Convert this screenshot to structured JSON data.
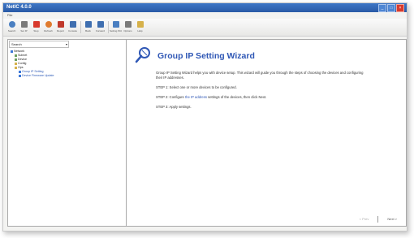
{
  "window": {
    "title": "NetIC 4.0.0",
    "controls": [
      "_",
      "□",
      "×"
    ]
  },
  "menu": {
    "label": "File"
  },
  "toolbar": {
    "groups": [
      {
        "items": [
          {
            "icon": "search-icon",
            "label": "Search",
            "color": "#4a7fc1"
          },
          {
            "icon": "pencil-icon",
            "label": "Set IP",
            "color": "#7a7a7a"
          },
          {
            "icon": "stop-icon",
            "label": "Stop",
            "color": "#d83a2d"
          },
          {
            "icon": "refresh-icon",
            "label": "Refresh",
            "color": "#e07b2e"
          },
          {
            "icon": "print-icon",
            "label": "Report",
            "color": "#c0392b"
          },
          {
            "icon": "monitor-icon",
            "label": "Console",
            "color": "#3f6fb0"
          }
        ]
      },
      {
        "items": [
          {
            "icon": "back-icon",
            "label": "Back",
            "color": "#3f6fb0"
          },
          {
            "icon": "forward-icon",
            "label": "Forward",
            "color": "#3f6fb0"
          }
        ]
      },
      {
        "items": [
          {
            "icon": "wizard-icon",
            "label": "Setting Wizard",
            "color": "#4a7fc1"
          },
          {
            "icon": "pin-icon",
            "label": "Options",
            "color": "#7a7a7a"
          },
          {
            "icon": "lock-icon",
            "label": "Help",
            "color": "#d6b14a"
          }
        ]
      }
    ]
  },
  "tree": {
    "selector": "Search",
    "nodes": [
      {
        "text": "Network",
        "indent": 0,
        "mark": "b"
      },
      {
        "text": "Subnet",
        "indent": 1,
        "mark": "g"
      },
      {
        "text": "Device",
        "indent": 1,
        "mark": "g"
      },
      {
        "text": "Config",
        "indent": 1,
        "mark": "y"
      },
      {
        "text": "Ops",
        "indent": 1,
        "mark": "y"
      },
      {
        "text": "Group IP Setting",
        "indent": 2,
        "mark": "b",
        "blue": true
      },
      {
        "text": "Device Firmware Update",
        "indent": 2,
        "mark": "b",
        "blue": true
      }
    ]
  },
  "wizard": {
    "title": "Group IP Setting Wizard",
    "intro": "Group IP Setting Wizard helps you with device setup. This wizard will guide you through the steps of choosing the devices and configuring their IP addresses.",
    "step1": "STEP 1: Select one or more devices to be configured.",
    "step2_prefix": "STEP 2: Configure ",
    "step2_link": "the IP address",
    "step2_suffix": " settings of the devices, then click Next.",
    "step3": "STEP 3: Apply settings."
  },
  "footer": {
    "prev": "< Prev",
    "next": "Next >"
  }
}
